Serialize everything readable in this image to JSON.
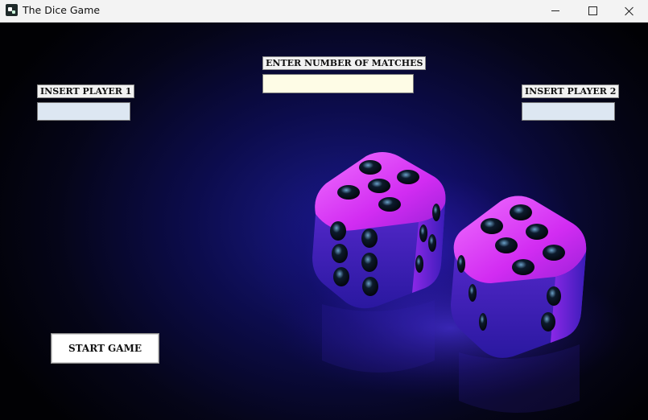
{
  "window": {
    "title": "The Dice Game",
    "icon": "dice-app-icon",
    "controls": [
      "minimize-icon",
      "maximize-icon",
      "close-icon"
    ]
  },
  "form": {
    "player1": {
      "label": "INSERT PLAYER 1",
      "value": ""
    },
    "player2": {
      "label": "INSERT PLAYER 2",
      "value": ""
    },
    "matches": {
      "label": "ENTER NUMBER OF MATCHES",
      "value": ""
    }
  },
  "actions": {
    "start_label": "START GAME"
  },
  "colors": {
    "background": "#0c0c4c",
    "die_top": "#e23cff",
    "die_side": "#4a28d8",
    "player_field": "#dde7f2",
    "matches_field": "#fefce6"
  }
}
